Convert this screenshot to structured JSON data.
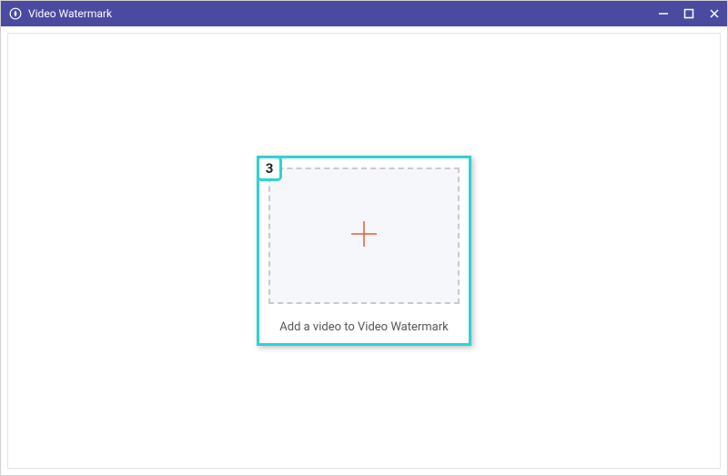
{
  "titlebar": {
    "title": "Video Watermark"
  },
  "highlight": {
    "step_number": "3"
  },
  "dropzone": {
    "caption": "Add a video to Video Watermark"
  }
}
